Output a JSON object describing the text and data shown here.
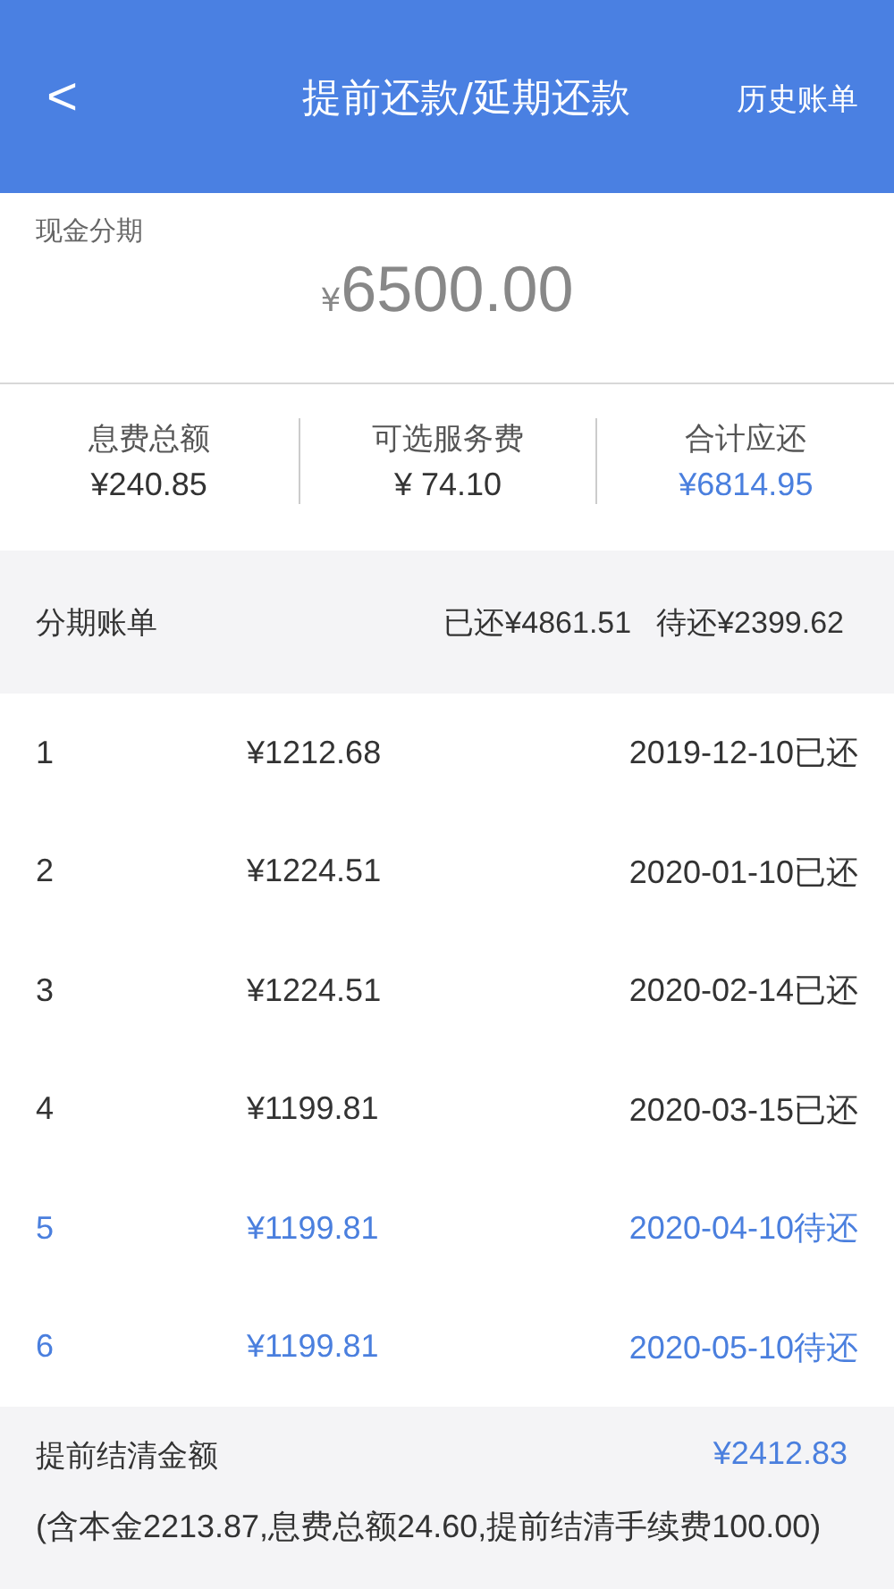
{
  "header": {
    "back": "<",
    "title": "提前还款/延期还款",
    "action": "历史账单"
  },
  "loan": {
    "label": "现金分期",
    "currency": "¥",
    "amount": "6500.00"
  },
  "stats": [
    {
      "label": "息费总额",
      "value": "¥240.85",
      "highlight": false
    },
    {
      "label": "可选服务费",
      "value": "¥ 74.10",
      "highlight": false
    },
    {
      "label": "合计应还",
      "value": "¥6814.95",
      "highlight": true
    }
  ],
  "bill": {
    "title": "分期账单",
    "paid": "已还¥4861.51",
    "pending": "待还¥2399.62"
  },
  "rows": [
    {
      "no": "1",
      "amount": "¥1212.68",
      "date": "2019-12-10已还",
      "pending": false
    },
    {
      "no": "2",
      "amount": "¥1224.51",
      "date": "2020-01-10已还",
      "pending": false
    },
    {
      "no": "3",
      "amount": "¥1224.51",
      "date": "2020-02-14已还",
      "pending": false
    },
    {
      "no": "4",
      "amount": "¥1199.81",
      "date": "2020-03-15已还",
      "pending": false
    },
    {
      "no": "5",
      "amount": "¥1199.81",
      "date": "2020-04-10待还",
      "pending": true
    },
    {
      "no": "6",
      "amount": "¥1199.81",
      "date": "2020-05-10待还",
      "pending": true
    }
  ],
  "settle": {
    "label": "提前结清金额",
    "amount": "¥2412.83",
    "detail": "(含本金2213.87,息费总额24.60,提前结清手续费100.00)"
  }
}
